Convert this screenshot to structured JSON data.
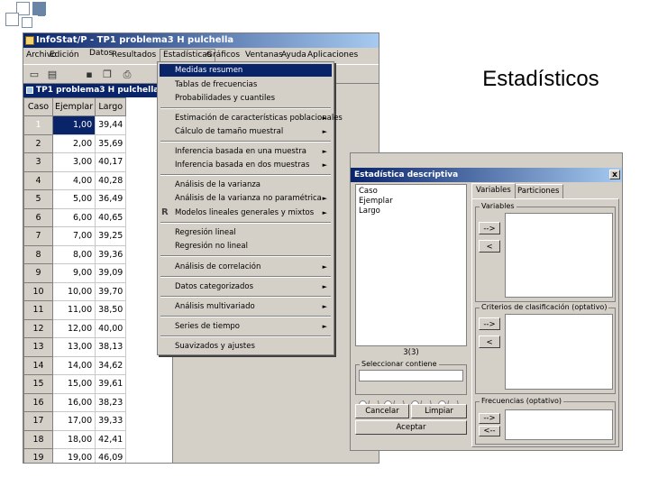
{
  "slide": {
    "title": "Estadísticos"
  },
  "window": {
    "title": "InfoStat/P - TP1 problema3 H pulchella",
    "menu": [
      "Archivo",
      "Edición",
      "Datos",
      "Resultados",
      "Estadísticas",
      "Gráficos",
      "Ventanas",
      "Ayuda",
      "Aplicaciones"
    ]
  },
  "data_window": {
    "title": "TP1 problema3 H pulchella",
    "columns": [
      "Caso",
      "Ejemplar",
      "Largo"
    ],
    "rows": [
      [
        "1",
        "1,00",
        "39,44"
      ],
      [
        "2",
        "2,00",
        "35,69"
      ],
      [
        "3",
        "3,00",
        "40,17"
      ],
      [
        "4",
        "4,00",
        "40,28"
      ],
      [
        "5",
        "5,00",
        "36,49"
      ],
      [
        "6",
        "6,00",
        "40,65"
      ],
      [
        "7",
        "7,00",
        "39,25"
      ],
      [
        "8",
        "8,00",
        "39,36"
      ],
      [
        "9",
        "9,00",
        "39,09"
      ],
      [
        "10",
        "10,00",
        "39,70"
      ],
      [
        "11",
        "11,00",
        "38,50"
      ],
      [
        "12",
        "12,00",
        "40,00"
      ],
      [
        "13",
        "13,00",
        "38,13"
      ],
      [
        "14",
        "14,00",
        "34,62"
      ],
      [
        "15",
        "15,00",
        "39,61"
      ],
      [
        "16",
        "16,00",
        "38,23"
      ],
      [
        "17",
        "17,00",
        "39,33"
      ],
      [
        "18",
        "18,00",
        "42,41"
      ],
      [
        "19",
        "19,00",
        "46,09"
      ]
    ]
  },
  "stats_menu": {
    "items": [
      {
        "label": "Medidas resumen",
        "submenu": false
      },
      {
        "label": "Tablas de frecuencias",
        "submenu": false
      },
      {
        "label": "Probabilidades y cuantiles",
        "submenu": false
      },
      {
        "label": "Estimación de características poblacionales",
        "submenu": true
      },
      {
        "label": "Cálculo de tamaño muestral",
        "submenu": true
      },
      {
        "label": "Inferencia basada en una muestra",
        "submenu": true
      },
      {
        "label": "Inferencia basada en dos muestras",
        "submenu": true
      },
      {
        "label": "Análisis de la varianza",
        "submenu": false
      },
      {
        "label": "Análisis de la varianza no paramétrica",
        "submenu": true
      },
      {
        "label": "Modelos lineales generales y mixtos",
        "submenu": true
      },
      {
        "label": "Regresión lineal",
        "submenu": false
      },
      {
        "label": "Regresión no lineal",
        "submenu": false
      },
      {
        "label": "Análisis de correlación",
        "submenu": true
      },
      {
        "label": "Datos categorizados",
        "submenu": true
      },
      {
        "label": "Análisis multivariado",
        "submenu": true
      },
      {
        "label": "Series de tiempo",
        "submenu": true
      },
      {
        "label": "Suavizados y ajustes",
        "submenu": false
      }
    ]
  },
  "dialog": {
    "title": "Estadística descriptiva",
    "variables_list": [
      "Caso",
      "Ejemplar",
      "Largo"
    ],
    "count": "3(3)",
    "tabs": [
      "Variables",
      "Particiones"
    ],
    "group_variables": "Variables",
    "group_criteria": "Criterios de clasificación (optativo)",
    "group_freq": "Frecuencias (optativo)",
    "group_select": "Seleccionar contiene",
    "arrow_right": "-->",
    "arrow_left": "<",
    "arrow_left2": "<--",
    "btn_cancel": "Cancelar",
    "btn_clear": "Limpiar",
    "btn_accept": "Aceptar",
    "close": "x"
  }
}
